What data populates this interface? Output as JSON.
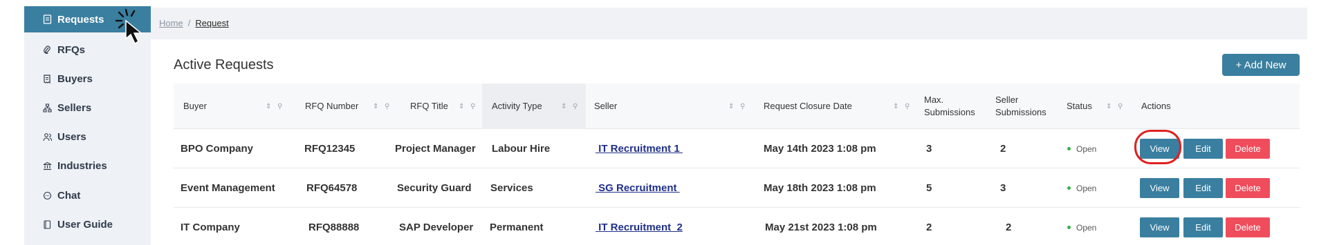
{
  "sidebar": {
    "items": [
      {
        "label": "Requests",
        "icon": "document-icon"
      },
      {
        "label": "RFQs",
        "icon": "paperclip-icon"
      },
      {
        "label": "Buyers",
        "icon": "receipt-icon"
      },
      {
        "label": "Sellers",
        "icon": "org-chart-icon"
      },
      {
        "label": "Users",
        "icon": "user-group-icon"
      },
      {
        "label": "Industries",
        "icon": "bank-icon"
      },
      {
        "label": "Chat",
        "icon": "chat-bubble-icon"
      },
      {
        "label": "User Guide",
        "icon": "book-icon"
      }
    ]
  },
  "breadcrumb": {
    "home": "Home",
    "separator": "/",
    "current": "Request"
  },
  "page": {
    "title": "Active Requests",
    "add_button": "+ Add New"
  },
  "table": {
    "headers": {
      "buyer": "Buyer",
      "rfq_number": "RFQ Number",
      "rfq_title": "RFQ Title",
      "activity_type": "Activity Type",
      "seller": "Seller",
      "closure_date": "Request Closure Date",
      "max_submissions_1": "Max.",
      "max_submissions_2": "Submissions",
      "seller_submissions_1": "Seller",
      "seller_submissions_2": "Submissions",
      "status": "Status",
      "actions": "Actions"
    },
    "rows": [
      {
        "buyer": "BPO Company",
        "rfq_number": "RFQ12345",
        "rfq_title": "Project Manager",
        "activity_type": "Labour Hire",
        "seller": " IT Recruitment 1 ",
        "closure_date": "May 14th 2023 1:08 pm",
        "max_submissions": "3",
        "seller_submissions": "2",
        "status": "Open"
      },
      {
        "buyer": "Event Management",
        "rfq_number": "RFQ64578",
        "rfq_title": "Security Guard",
        "activity_type": "Services",
        "seller": " SG Recruitment ",
        "closure_date": "May 18th 2023 1:08 pm",
        "max_submissions": "5",
        "seller_submissions": "3",
        "status": "Open"
      },
      {
        "buyer": "IT Company",
        "rfq_number": "RFQ88888",
        "rfq_title": "SAP Developer",
        "activity_type": "Permanent",
        "seller": " IT Recruitment  2",
        "closure_date": "May 21st 2023 1:08 pm",
        "max_submissions": "2",
        "seller_submissions": "2",
        "status": "Open"
      }
    ],
    "actions": {
      "view": "View",
      "edit": "Edit",
      "delete": "Delete"
    }
  },
  "colors": {
    "accent": "#3a7fa0",
    "danger": "#ef4d5c",
    "status_open": "#34b34a",
    "highlight": "#e02020"
  }
}
